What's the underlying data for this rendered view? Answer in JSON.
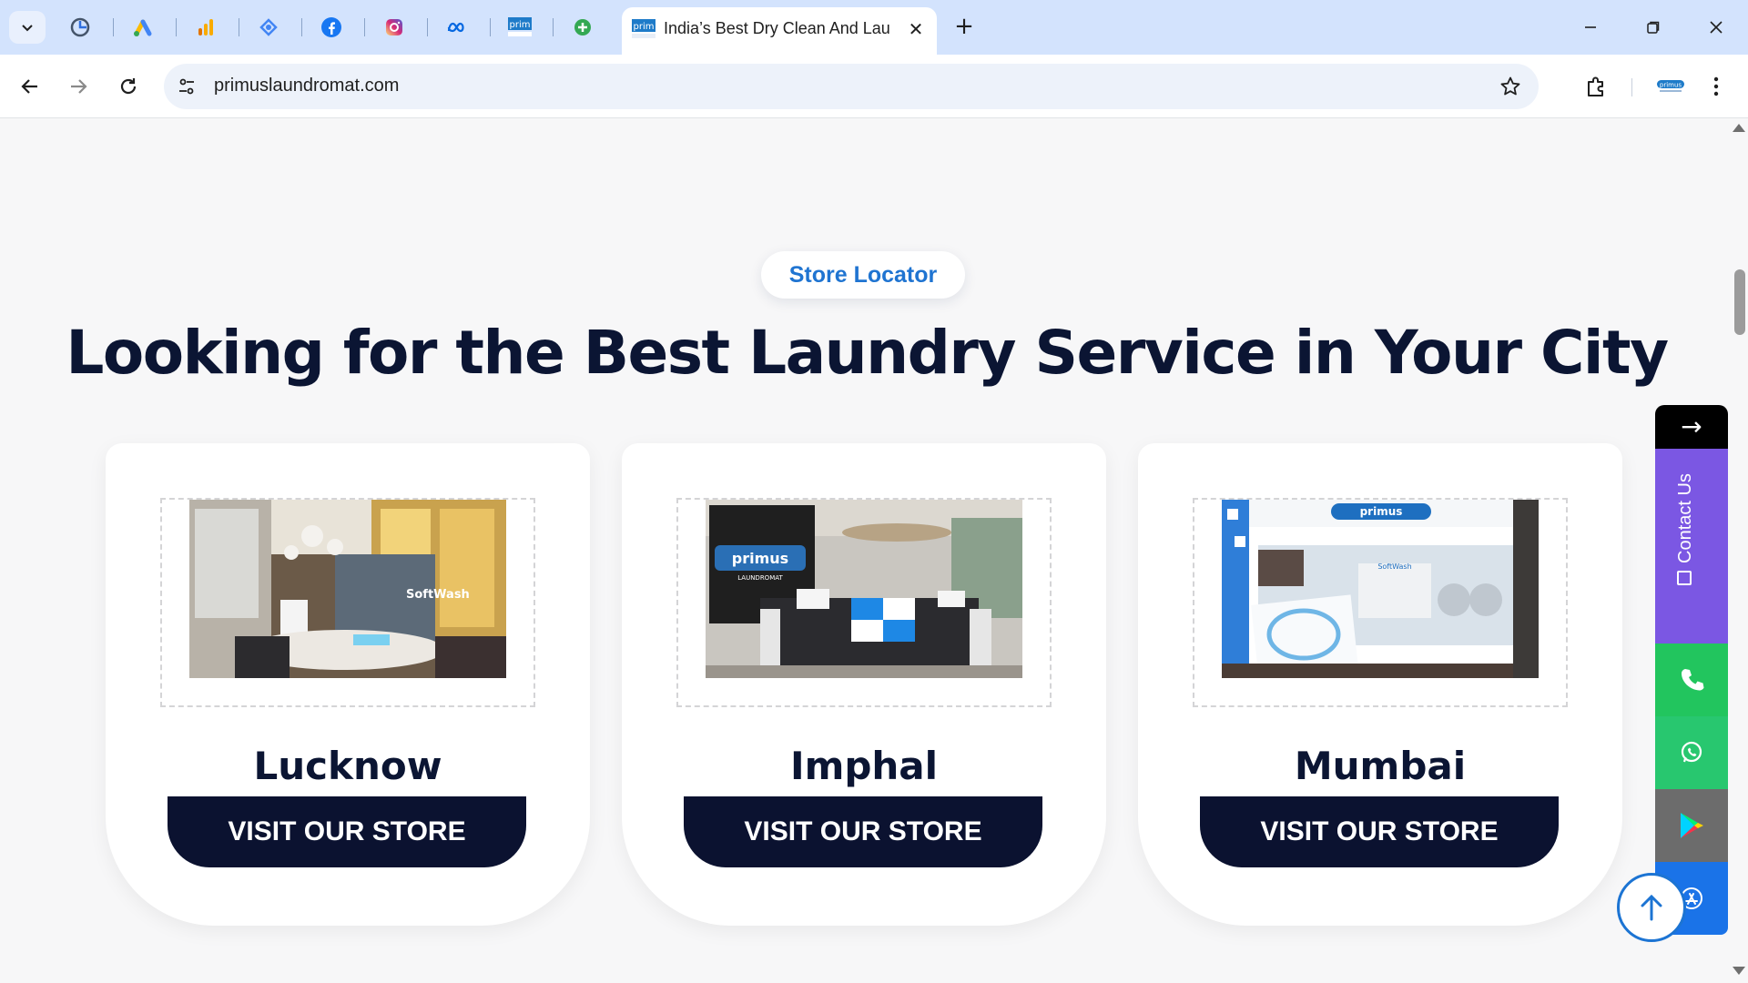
{
  "browser": {
    "pinned_tabs": [
      {
        "icon": "chart-app-icon"
      },
      {
        "icon": "google-ads-icon"
      },
      {
        "icon": "analytics-icon"
      },
      {
        "icon": "search-console-icon"
      },
      {
        "icon": "facebook-icon"
      },
      {
        "icon": "instagram-icon"
      },
      {
        "icon": "meta-icon"
      },
      {
        "icon": "primus-icon"
      },
      {
        "icon": "add-circle-icon"
      }
    ],
    "active_tab": {
      "title": "India’s Best Dry Clean And Laundry",
      "close": "✕"
    },
    "new_tab": "+",
    "url": "primuslaundromat.com"
  },
  "page": {
    "badge": "Store Locator",
    "heading": "Looking for the Best Laundry Service in Your City",
    "stores": [
      {
        "city": "Lucknow",
        "button": "VISIT OUR STORE"
      },
      {
        "city": "Imphal",
        "button": "VISIT OUR STORE"
      },
      {
        "city": "Mumbai",
        "button": "VISIT OUR STORE"
      }
    ]
  },
  "floating": {
    "arrow": "→",
    "contact_label": "Contact Us",
    "colors": {
      "contact": "#7b57e3",
      "phone": "#22c55e",
      "whatsapp": "#28c76f",
      "play": "#6c6c6c",
      "appstore": "#1a73e8"
    }
  }
}
